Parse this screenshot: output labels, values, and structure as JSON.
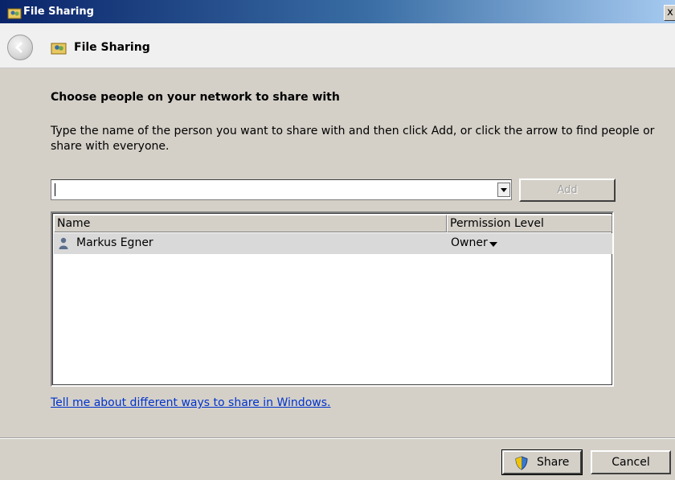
{
  "window": {
    "title": "File Sharing",
    "close_glyph": "x"
  },
  "nav": {
    "back_icon": "back-arrow-icon",
    "title": "File Sharing"
  },
  "main": {
    "heading": "Choose people on your network to share with",
    "instructions": "Type the name of the person you want to share with and then click Add, or click the arrow to find people or share with everyone.",
    "name_input": {
      "value": "",
      "placeholder": ""
    },
    "add_label": "Add",
    "table": {
      "columns": [
        "Name",
        "Permission Level"
      ],
      "rows": [
        {
          "name": "Markus Egner",
          "permission": "Owner",
          "icon": "user-icon"
        }
      ]
    },
    "help_link": "Tell me about different ways to share in Windows."
  },
  "footer": {
    "share_label": "Share",
    "cancel_label": "Cancel"
  },
  "colors": {
    "titlebar": "#0a246a",
    "dialog_bg": "#d4d0c8",
    "link": "#0033cc",
    "selected_row": "#d9d9d9"
  }
}
